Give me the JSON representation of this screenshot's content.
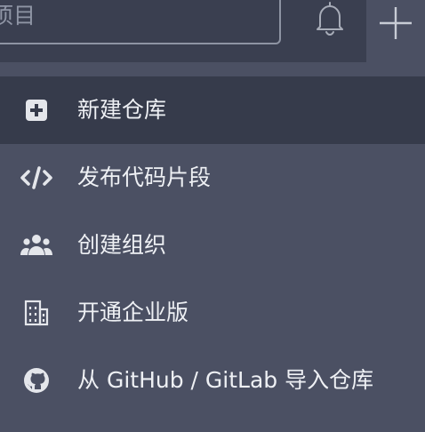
{
  "header": {
    "search_placeholder": "项目",
    "notifications_icon": "bell-icon",
    "create_icon": "plus-icon"
  },
  "menu": {
    "items": [
      {
        "label": "新建仓库",
        "icon": "add-square-icon",
        "active": true
      },
      {
        "label": "发布代码片段",
        "icon": "code-icon",
        "active": false
      },
      {
        "label": "创建组织",
        "icon": "users-icon",
        "active": false
      },
      {
        "label": "开通企业版",
        "icon": "building-icon",
        "active": false
      },
      {
        "label": "从 GitHub / GitLab 导入仓库",
        "icon": "github-icon",
        "active": false
      }
    ]
  },
  "colors": {
    "background": "#4b5063",
    "topbar": "#3a3f50",
    "active_item": "#363b4b",
    "text": "#eef0f4",
    "icon": "#e4e6eb",
    "muted": "#8f95a5"
  }
}
